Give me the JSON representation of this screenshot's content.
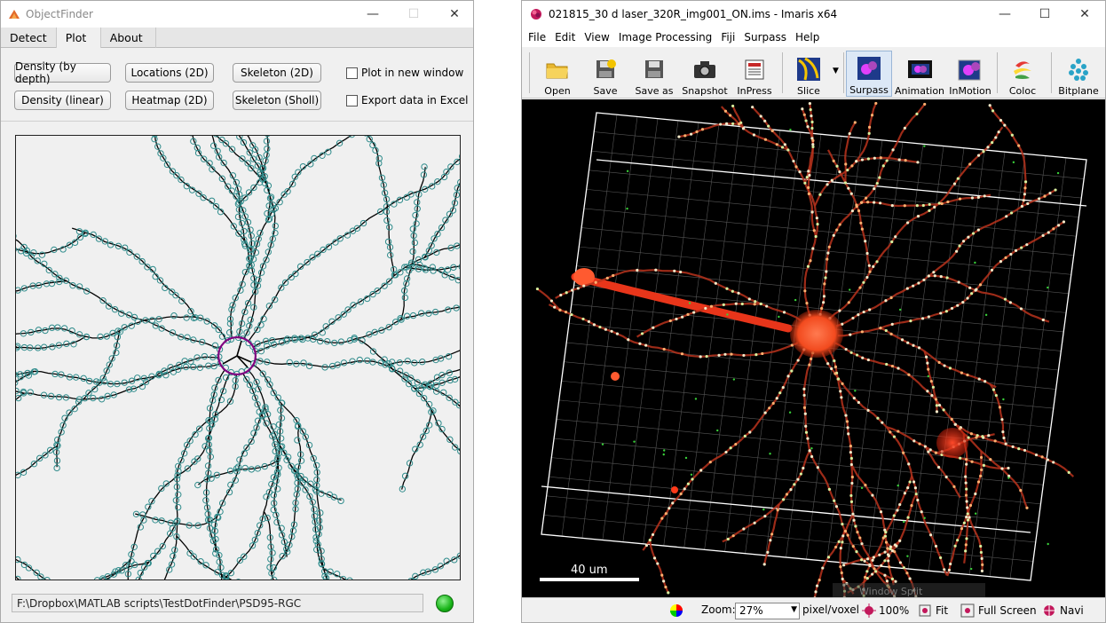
{
  "objectfinder": {
    "title": "ObjectFinder",
    "tabs": [
      "Detect",
      "Plot",
      "About"
    ],
    "buttons": {
      "density_depth": "Density (by depth)",
      "locations": "Locations (2D)",
      "skeleton": "Skeleton (2D)",
      "density_linear": "Density (linear)",
      "heatmap": "Heatmap (2D)",
      "sholl": "Skeleton (Sholl)"
    },
    "checks": {
      "new_window": "Plot in new window",
      "export_excel": "Export data in Excel"
    },
    "path": "F:\\Dropbox\\MATLAB scripts\\TestDotFinder\\PSD95-RGC",
    "colors": {
      "marker": "#2e8b8b",
      "soma": "#800080",
      "skeleton": "#000000"
    }
  },
  "imaris": {
    "title": "021815_30 d laser_320R_img001_ON.ims  - Imaris x64",
    "menus": [
      "File",
      "Edit",
      "View",
      "Image Processing",
      "Fiji",
      "Surpass",
      "Help"
    ],
    "tools": {
      "open": "Open",
      "save": "Save",
      "saveas": "Save as",
      "snapshot": "Snapshot",
      "inpress": "InPress",
      "slice": "Slice",
      "surpass": "Surpass",
      "animation": "Animation",
      "inmotion": "InMotion",
      "coloc": "Coloc",
      "bitplane": "Bitplane"
    },
    "scalebar": "40 um",
    "faded_text": "Window Split",
    "status": {
      "zoom_label": "Zoom:",
      "zoom_value": "27%",
      "unit": "pixel/voxel",
      "hundred": "100%",
      "fit": "Fit",
      "fullscreen": "Full Screen",
      "navi": "Navi"
    }
  }
}
